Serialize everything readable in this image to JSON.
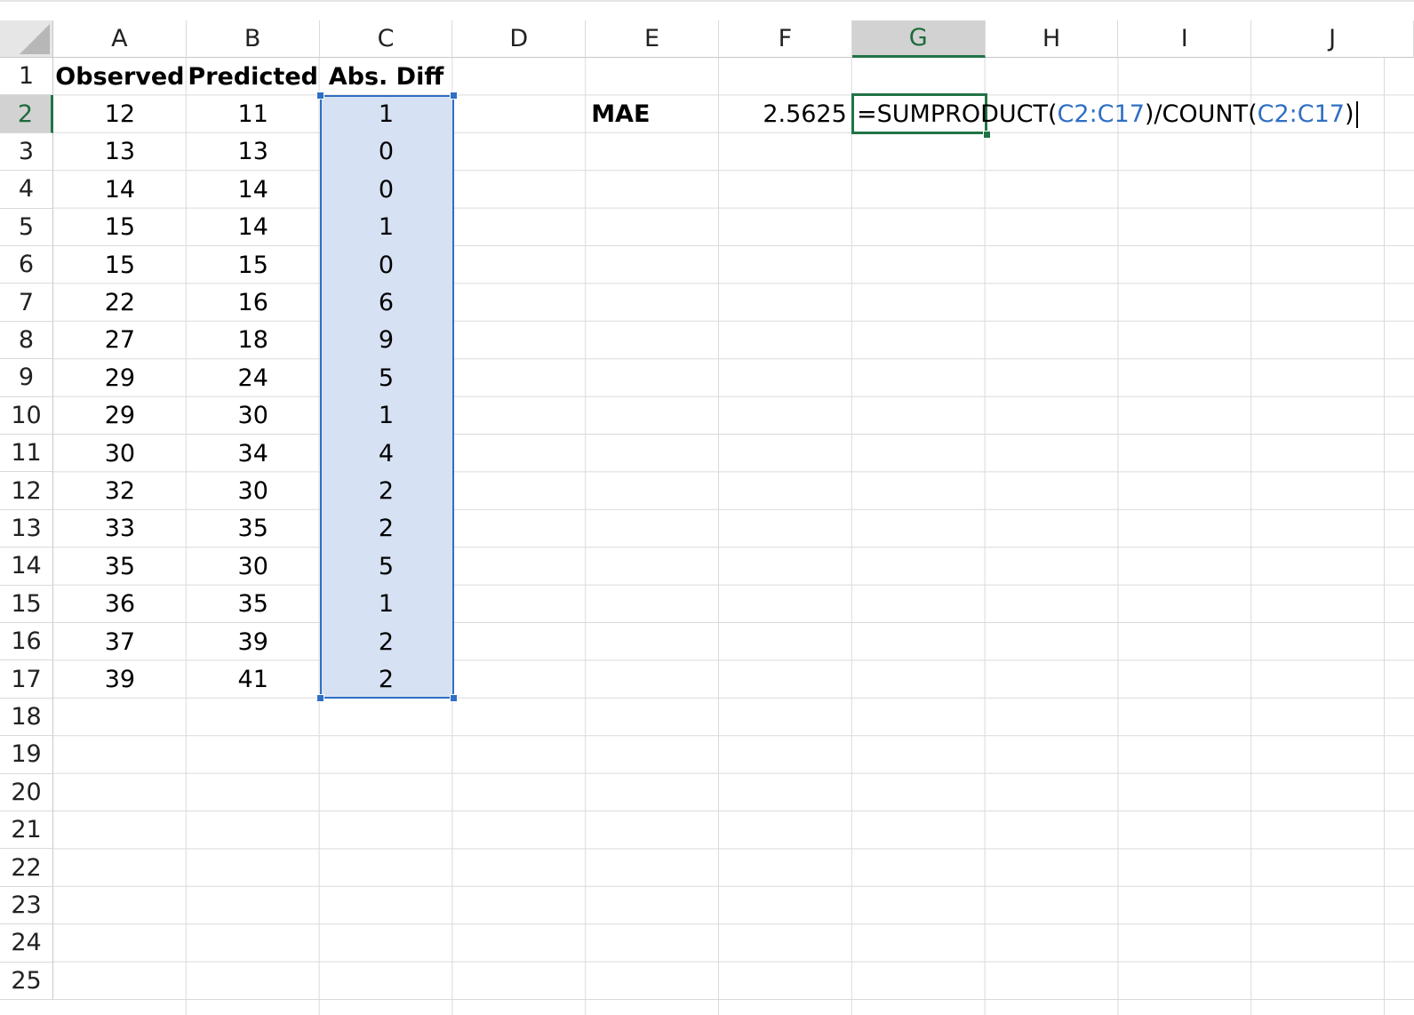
{
  "columns": [
    "A",
    "B",
    "C",
    "D",
    "E",
    "F",
    "G",
    "H",
    "I",
    "J"
  ],
  "rows": [
    "1",
    "2",
    "3",
    "4",
    "5",
    "6",
    "7",
    "8",
    "9",
    "10",
    "11",
    "12",
    "13",
    "14",
    "15",
    "16",
    "17",
    "18",
    "19",
    "20",
    "21",
    "22",
    "23",
    "24",
    "25"
  ],
  "active_column": "G",
  "active_row": "2",
  "headers": {
    "observed": "Observed",
    "predicted": "Predicted",
    "abs_diff": "Abs. Diff"
  },
  "observed": [
    "12",
    "13",
    "14",
    "15",
    "15",
    "22",
    "27",
    "29",
    "29",
    "30",
    "32",
    "33",
    "35",
    "36",
    "37",
    "39"
  ],
  "predicted": [
    "11",
    "13",
    "14",
    "14",
    "15",
    "16",
    "18",
    "24",
    "30",
    "34",
    "30",
    "35",
    "30",
    "35",
    "39",
    "41"
  ],
  "abs_diff": [
    "1",
    "0",
    "0",
    "1",
    "0",
    "6",
    "9",
    "5",
    "1",
    "4",
    "2",
    "2",
    "5",
    "1",
    "2",
    "2"
  ],
  "mae_label": "MAE",
  "mae_value": "2.5625",
  "formula": {
    "part1": "=SUMPRODUCT(",
    "ref1": "C2:C17",
    "part2": ")/COUNT(",
    "ref2": "C2:C17",
    "part3": ")"
  },
  "colors": {
    "selection_fill": "#d6e2f3",
    "selection_border": "#2f6fc4",
    "active_green": "#217346"
  }
}
